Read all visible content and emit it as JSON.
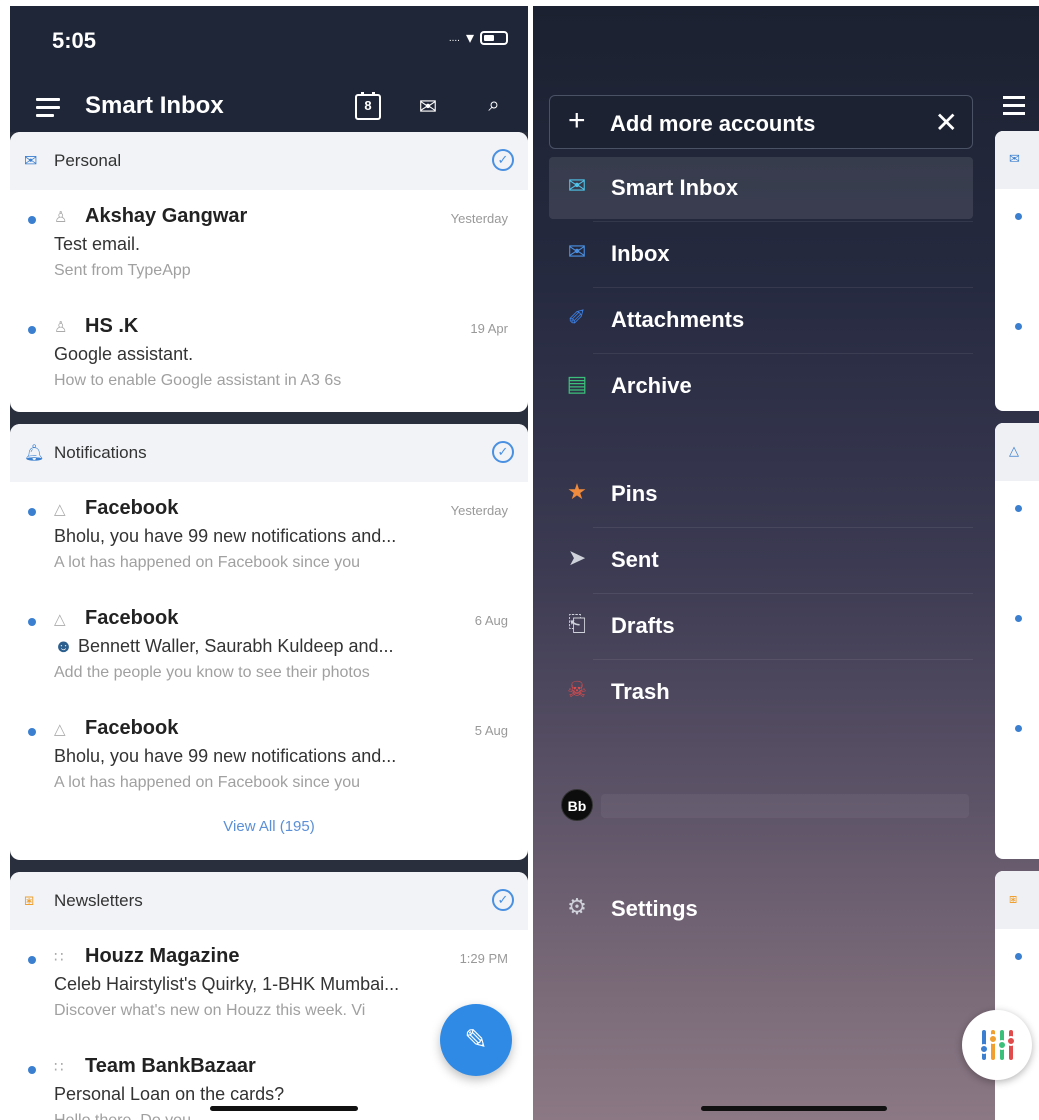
{
  "left": {
    "status_time": "5:05",
    "status_signal": "....",
    "toolbar_title": "Smart Inbox",
    "calendar_day": "8",
    "sections": [
      {
        "title": "Personal",
        "icon": "envelope-icon",
        "mails": [
          {
            "sender": "Akshay Gangwar",
            "date": "Yesterday",
            "subject": "Test email.",
            "preview": "Sent from TypeApp"
          },
          {
            "sender": "HS .K",
            "date": "19 Apr",
            "subject": "Google assistant.",
            "preview": "How to enable Google assistant in A3 6s"
          }
        ]
      },
      {
        "title": "Notifications",
        "icon": "bell-icon",
        "mails": [
          {
            "sender": "Facebook",
            "date": "Yesterday",
            "subject": "Bholu, you have 99 new notifications and...",
            "preview": "A lot has happened on Facebook since you"
          },
          {
            "sender": "Facebook",
            "date": "6 Aug",
            "subject": "Bennett Waller, Saurabh Kuldeep and...",
            "preview": "Add the people you know to see their photos"
          },
          {
            "sender": "Facebook",
            "date": "5 Aug",
            "subject": "Bholu, you have 99 new notifications and...",
            "preview": "A lot has happened on Facebook since you"
          }
        ],
        "view_all": "View All (195)"
      },
      {
        "title": "Newsletters",
        "icon": "rss-icon",
        "mails": [
          {
            "sender": "Houzz Magazine",
            "date": "1:29 PM",
            "subject": "Celeb Hairstylist's Quirky, 1-BHK Mumbai...",
            "preview": "Discover what's new on Houzz this week. Vi"
          },
          {
            "sender": "Team BankBazaar",
            "date": "",
            "subject": "Personal Loan on the cards?",
            "preview": "Hello there, Do you..."
          }
        ]
      }
    ]
  },
  "drawer": {
    "add_accounts": "Add more accounts",
    "items_primary": [
      {
        "label": "Smart Inbox",
        "icon": "smart-inbox-icon",
        "color": "#4fc3e8",
        "active": true
      },
      {
        "label": "Inbox",
        "icon": "inbox-icon",
        "color": "#4a90e2",
        "active": false
      },
      {
        "label": "Attachments",
        "icon": "paperclip-icon",
        "color": "#3b7ddd",
        "active": false
      },
      {
        "label": "Archive",
        "icon": "archive-icon",
        "color": "#3bbf7a",
        "active": false
      }
    ],
    "items_secondary": [
      {
        "label": "Pins",
        "icon": "pin-icon",
        "color": "#f08a3c"
      },
      {
        "label": "Sent",
        "icon": "send-icon",
        "color": "#cfd2da"
      },
      {
        "label": "Drafts",
        "icon": "draft-icon",
        "color": "#cfd2da"
      },
      {
        "label": "Trash",
        "icon": "trash-icon",
        "color": "#e24b4b"
      }
    ],
    "account_logo": "Bb",
    "settings": "Settings"
  },
  "colors": {
    "accent": "#2f8ae5",
    "toolbar": "#1f2637",
    "unread_dot": "#3a7fd0"
  }
}
